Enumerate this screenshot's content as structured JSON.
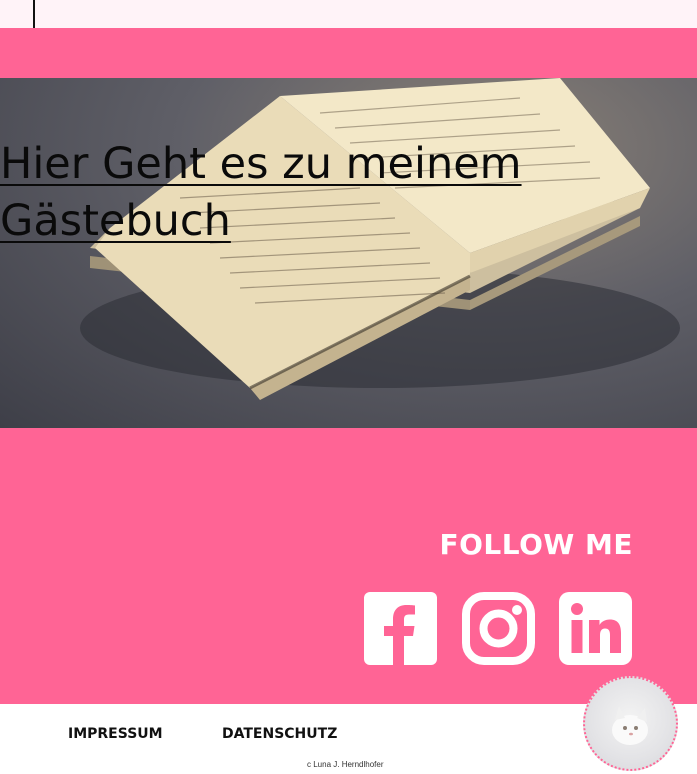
{
  "hero": {
    "link_text": "Hier Geht es zu meinem Gästebuch"
  },
  "follow": {
    "title": "FOLLOW ME",
    "icons": [
      "facebook-icon",
      "instagram-icon",
      "linkedin-icon"
    ]
  },
  "footer": {
    "impressum": "IMPRESSUM",
    "datenschutz": "DATENSCHUTZ",
    "copyright": "c Luna J. Herndlhofer"
  },
  "colors": {
    "brand_pink": "#ff6495",
    "top_bar": "#fff3f8",
    "white": "#ffffff"
  }
}
